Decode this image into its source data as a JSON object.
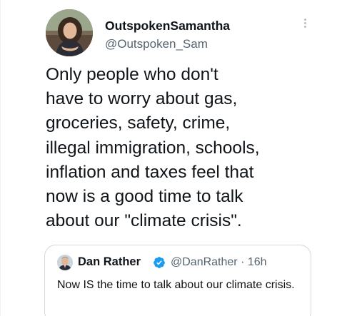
{
  "tweet": {
    "author": {
      "display_name": "OutspokenSamantha",
      "handle": "@Outspoken_Sam",
      "avatar_icon": "profile-photo-avatar"
    },
    "more_icon": "more-vertical-icon",
    "text": "Only people who don't\nhave to worry about gas,\ngroceries, safety, crime,\nillegal immigration, schools,\ninflation and taxes feel that\nnow is a good time to talk\nabout our \"climate crisis\"."
  },
  "quote": {
    "author": {
      "display_name": "Dan Rather",
      "verified_icon": "verified-badge-icon",
      "handle": "@DanRather",
      "separator": "·",
      "time": "16h"
    },
    "text": "Now IS the time to talk about our climate crisis."
  },
  "colors": {
    "text_primary": "#0f1419",
    "text_secondary": "#536471",
    "verified_blue": "#1d9bf0",
    "border": "#cfd9de"
  }
}
